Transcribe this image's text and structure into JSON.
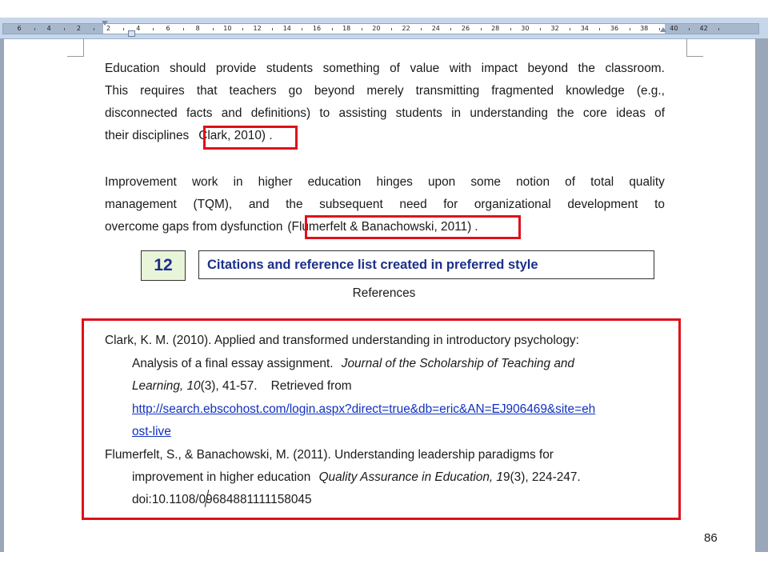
{
  "ruler": {
    "labels": [
      "6",
      "4",
      "2",
      "2",
      "4",
      "6",
      "8",
      "10",
      "12",
      "14",
      "16",
      "18",
      "20",
      "22",
      "24",
      "26",
      "28",
      "30",
      "32",
      "34",
      "36",
      "38",
      "40",
      "42"
    ]
  },
  "paragraph1": {
    "lines": [
      [
        "Education",
        "should",
        "provide",
        "students",
        "something",
        "of",
        "value",
        "with",
        "impact",
        "beyond",
        "the",
        "classroom."
      ],
      [
        "This",
        "requires",
        "that",
        "teachers",
        "go",
        "beyond",
        "merely",
        "transmitting",
        "fragmented",
        "knowledge",
        "(e.g.,"
      ],
      [
        "disconnected",
        "facts",
        "and",
        "definitions)",
        "to",
        "assisting",
        "students",
        "in",
        "understanding",
        "the",
        "core",
        "ideas",
        "of"
      ]
    ],
    "last_line_prefix": "their disciplines",
    "citation": "Clark, 2010) ."
  },
  "paragraph2": {
    "lines": [
      [
        "Improvement",
        "work",
        "in",
        "higher",
        "education",
        "hinges",
        "upon",
        "some",
        "notion",
        "of",
        "total",
        "quality"
      ],
      [
        "management",
        "(TQM),",
        "and",
        "the",
        "subsequent",
        "need",
        "for",
        "organizational",
        "development",
        "to"
      ]
    ],
    "last_line_prefix": "overcome gaps from dysfunction",
    "citation": "(Flumerfelt & Banachowski, 2011)",
    "trailing": "."
  },
  "callout": {
    "number": "12",
    "text": "Citations and reference list created in preferred style"
  },
  "references": {
    "title": "References",
    "ref1": {
      "line1": "Clark, K. M. (2010). Applied and transformed understanding in introductory psychology:",
      "line2_plain": "Analysis of a final essay assignment.",
      "line2_italic": "Journal of the Scholarship of Teaching and",
      "line3_italic": "Learning, 10",
      "line3_plain": "(3), 41-57.    Retrieved from",
      "link1": "http://search.ebscohost.com/login.aspx?direct=true&db=eric&AN=EJ906469&site=eh",
      "link2": "ost-live"
    },
    "ref2": {
      "line1": "Flumerfelt, S., & Banachowski, M. (2011). Understanding leadership paradigms for",
      "line2_plain": "improvement in higher education",
      "line2_italic": "Quality Assurance in Education, 1",
      "line2_rest": "9(3), 224-247.",
      "line3": "doi:10.1108/09684881111158045"
    }
  },
  "page_number": "86",
  "colors": {
    "highlight_border": "#e0101a",
    "callout_text": "#1a2f8a",
    "callout_number_bg": "#e8f5d8",
    "link": "#1030c0"
  }
}
